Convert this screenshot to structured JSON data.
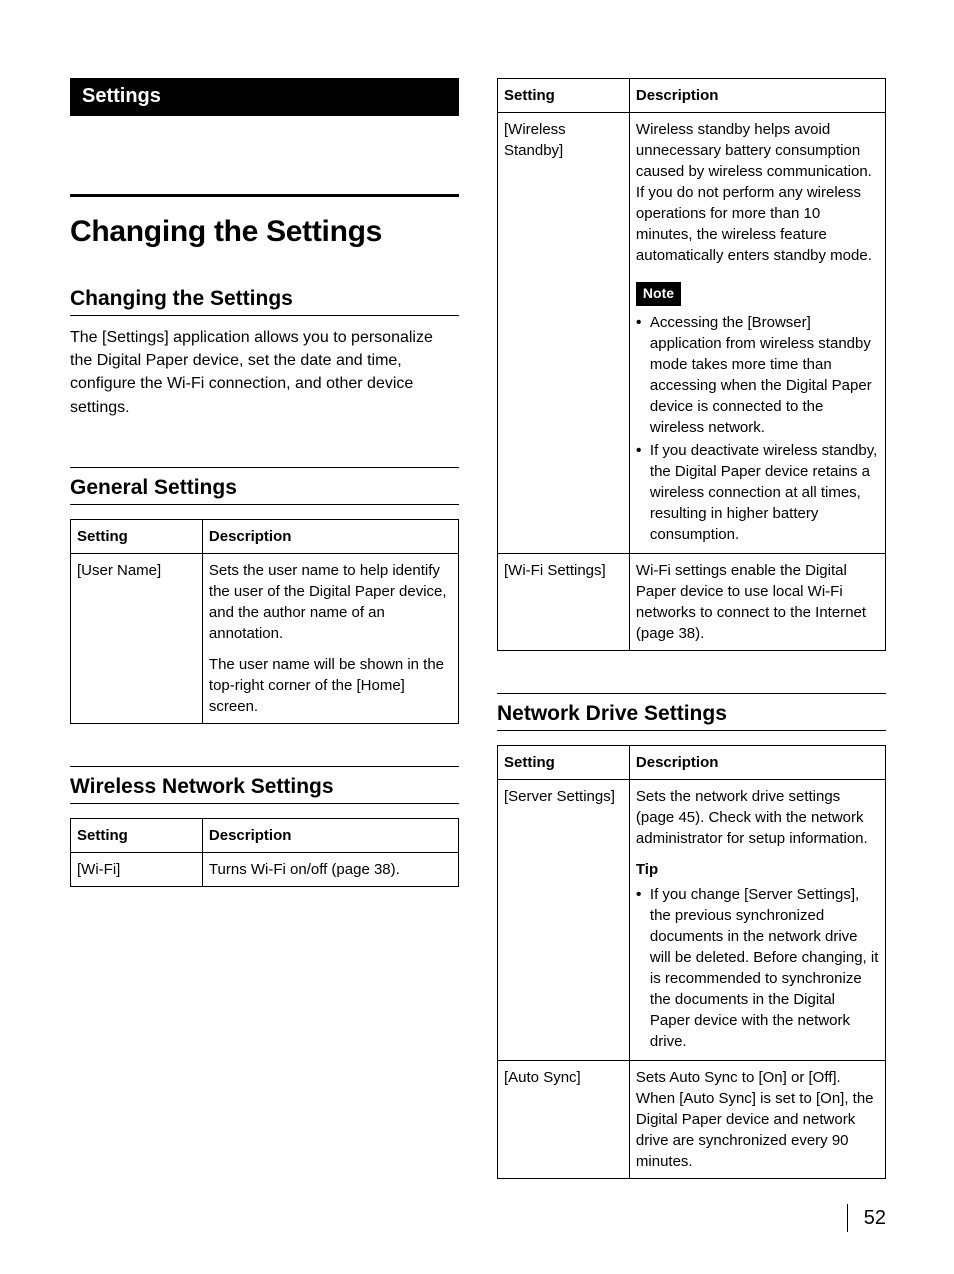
{
  "banner": "Settings",
  "main_title": "Changing the Settings",
  "sub_title": "Changing the Settings",
  "intro": "The [Settings] application allows you to personalize the Digital Paper device, set the date and time, configure the Wi-Fi connection, and other device settings.",
  "headers": {
    "setting": "Setting",
    "description": "Description"
  },
  "general": {
    "title": "General Settings",
    "rows": [
      {
        "setting": "[User Name]",
        "desc_p1": "Sets the user name to help identify the user of the Digital Paper device, and the author name of an annotation.",
        "desc_p2": "The user name will be shown in the top-right corner of the [Home] screen."
      }
    ]
  },
  "wireless": {
    "title": "Wireless Network Settings",
    "rows": [
      {
        "setting": "[Wi-Fi]",
        "desc": "Turns Wi-Fi on/off (page 38)."
      }
    ]
  },
  "wireless2": {
    "rows": [
      {
        "setting": "[Wireless Standby]",
        "desc": "Wireless standby helps avoid unnecessary battery consumption caused by wireless communication. If you do not perform any wireless operations for more than 10 minutes, the wireless feature automatically enters standby mode.",
        "note_label": "Note",
        "note_b1": "Accessing the [Browser] application from wireless standby mode takes more time than accessing when the Digital Paper device is connected to the wireless network.",
        "note_b2": "If you deactivate wireless standby, the Digital Paper device retains a wireless connection at all times, resulting in higher battery consumption."
      },
      {
        "setting": "[Wi-Fi Settings]",
        "desc": "Wi-Fi settings enable the Digital Paper device to use local Wi-Fi networks to connect to the Internet (page 38)."
      }
    ]
  },
  "netdrive": {
    "title": "Network Drive Settings",
    "rows": [
      {
        "setting": "[Server Settings]",
        "desc": "Sets the network drive settings (page 45). Check with the network administrator for setup information.",
        "tip_label": "Tip",
        "tip_b1": "If you change [Server Settings], the previous synchronized documents in the network drive will be deleted. Before changing, it is recommended to synchronize the documents in the Digital Paper device with the network drive."
      },
      {
        "setting": "[Auto Sync]",
        "desc": "Sets Auto Sync to [On] or [Off]. When [Auto Sync] is set to [On], the Digital Paper device and network drive are synchronized every 90 minutes."
      }
    ]
  },
  "page_number": "52"
}
